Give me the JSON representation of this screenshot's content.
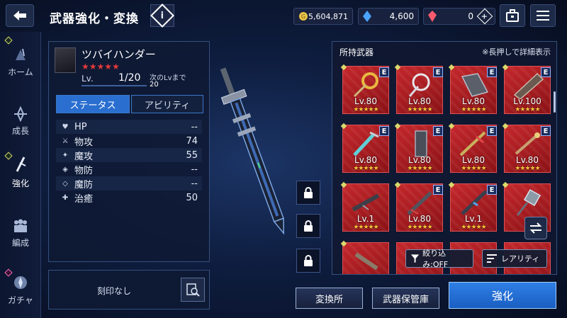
{
  "header": {
    "title": "武器強化・変換",
    "info_icon": "info-icon",
    "gold": "5,604,871",
    "crystal": "4,600",
    "ruby": "0",
    "colors": {
      "gold": "#e8c44a",
      "crystal": "#4aa3ff",
      "ruby": "#ff5a6e"
    }
  },
  "nav": {
    "items": [
      {
        "label": "ホーム",
        "icon": "home-icon"
      },
      {
        "label": "成長",
        "icon": "growth-icon"
      },
      {
        "label": "強化",
        "icon": "enhance-icon",
        "active": true
      },
      {
        "label": "編成",
        "icon": "party-icon"
      },
      {
        "label": "ガチャ",
        "icon": "gacha-icon"
      }
    ]
  },
  "weapon": {
    "name": "ツバイハンダー",
    "rarity_stars": 5,
    "stars": "★★★★★",
    "lv_label": "Lv.",
    "lv_value": "1/20",
    "next_lv_label": "次のLvまで",
    "next_lv_value": "20",
    "tabs": {
      "status": "ステータス",
      "ability": "アビリティ"
    },
    "stats": [
      {
        "icon": "hp-icon",
        "label": "HP",
        "value": "--"
      },
      {
        "icon": "physical-attack-icon",
        "label": "物攻",
        "value": "74"
      },
      {
        "icon": "magic-attack-icon",
        "label": "魔攻",
        "value": "55"
      },
      {
        "icon": "physical-defense-icon",
        "label": "物防",
        "value": "--"
      },
      {
        "icon": "magic-defense-icon",
        "label": "魔防",
        "value": "--"
      },
      {
        "icon": "healing-icon",
        "label": "治癒",
        "value": "50"
      }
    ],
    "engrave": "刻印なし"
  },
  "inventory": {
    "title": "所持武器",
    "hint": "※長押しで詳細表示",
    "items": [
      {
        "lv": "Lv.80",
        "stars": "★★★★★",
        "badge": "E"
      },
      {
        "lv": "Lv.80",
        "stars": "★★★★★",
        "badge": "E"
      },
      {
        "lv": "Lv.80",
        "stars": "★★★★★",
        "badge": "E"
      },
      {
        "lv": "Lv.100",
        "stars": "★★★★★",
        "badge": "E"
      },
      {
        "lv": "Lv.80",
        "stars": "★★★★★",
        "badge": "E"
      },
      {
        "lv": "Lv.80",
        "stars": "★★★★★",
        "badge": "E"
      },
      {
        "lv": "Lv.80",
        "stars": "★★★★★",
        "badge": "E"
      },
      {
        "lv": "Lv.80",
        "stars": "★★★★★",
        "badge": "E"
      },
      {
        "lv": "Lv.1",
        "stars": "★★★★★",
        "badge": ""
      },
      {
        "lv": "Lv.80",
        "stars": "★★★★★",
        "badge": "E"
      },
      {
        "lv": "Lv.1",
        "stars": "★★★★★",
        "badge": "E"
      },
      {
        "lv": "",
        "stars": "",
        "badge": ""
      }
    ],
    "filter_label": "絞り込み:OFF",
    "sort_label": "レアリティ"
  },
  "buttons": {
    "exchange": "変換所",
    "storage": "武器保管庫",
    "enhance": "強化"
  }
}
